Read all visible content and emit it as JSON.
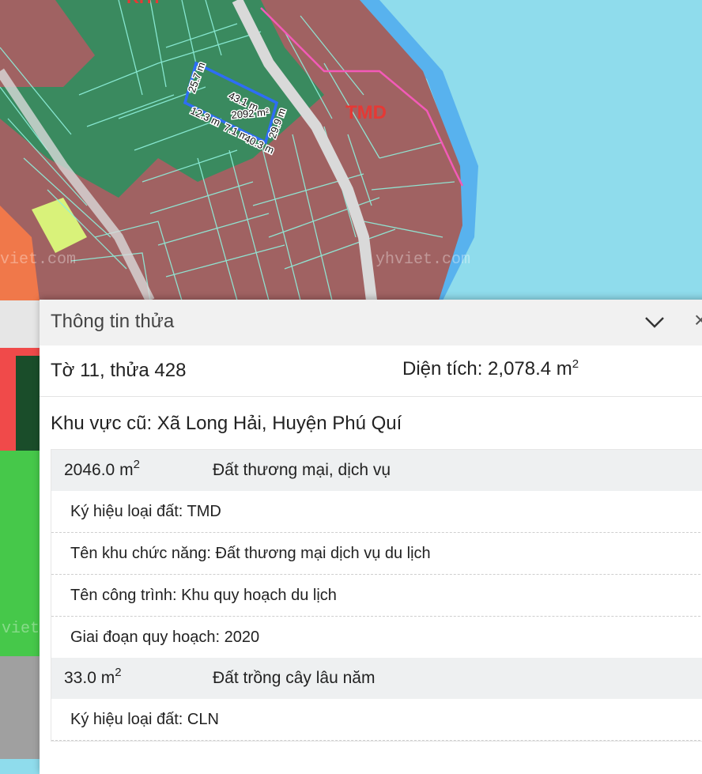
{
  "map": {
    "labels": {
      "zone_top": "KHT",
      "zone_main": "TMD",
      "watermark_1": "viet.com",
      "watermark_2": "yhviet.com",
      "watermark_3": "viet"
    },
    "parcel_measurements": {
      "side_left": "25.7 m",
      "side_top": "43.1 m",
      "area": "2092 m²",
      "side_right": "29.9 m",
      "side_bottom_1": "12.3 m",
      "side_bottom_2": "7.1 m",
      "side_bottom_3": "40.3 m"
    },
    "colors": {
      "water": "#8fdcec",
      "commercial_zone": "#a06262",
      "green_zone": "#3a8a5f",
      "parcel_outline": "#8ff0dc",
      "selected_parcel": "#2e6df5",
      "boundary_pink": "#f35ab8",
      "road": "#d9d9d9"
    }
  },
  "panel": {
    "title": "Thông tin thửa",
    "collapse_icon": "chevron-down-icon",
    "close_icon": "close-icon",
    "parcel_id": "Tờ 11, thửa 428",
    "area_label": "Diện tích: 2,078.4 m",
    "area_superscript": "2",
    "old_region": "Khu vực cũ: Xã Long Hải, Huyện Phú Quí",
    "sections": [
      {
        "area": "2046.0 m",
        "area_superscript": "2",
        "land_type": "Đất thương mại, dịch vụ",
        "details": [
          "Ký hiệu loại đất: TMD",
          "Tên khu chức năng: Đất thương mại dịch vụ du lịch",
          "Tên công trình: Khu quy hoạch du lịch",
          "Giai đoạn quy hoạch: 2020"
        ]
      },
      {
        "area": "33.0 m",
        "area_superscript": "2",
        "land_type": "Đất trồng cây lâu năm",
        "details": [
          "Ký hiệu loại đất: CLN"
        ]
      }
    ]
  }
}
